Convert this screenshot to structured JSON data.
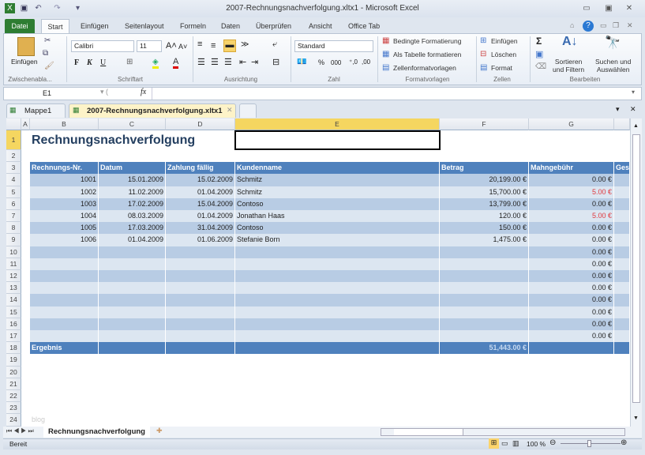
{
  "window": {
    "title": "2007-Rechnungsnachverfolgung.xltx1 - Microsoft Excel"
  },
  "ribbon_tabs": [
    "Datei",
    "Start",
    "Einfügen",
    "Seitenlayout",
    "Formeln",
    "Daten",
    "Überprüfen",
    "Ansicht",
    "Office Tab"
  ],
  "ribbon": {
    "clipboard": {
      "paste": "Einfügen",
      "label": "Zwischenabla..."
    },
    "font": {
      "name": "Calibri",
      "size": "11",
      "bold": "F",
      "italic": "K",
      "underline": "U",
      "label": "Schriftart"
    },
    "alignment": {
      "label": "Ausrichtung"
    },
    "number": {
      "format": "Standard",
      "percent": "%",
      "thousands": "000",
      "label": "Zahl"
    },
    "styles": {
      "conditional": "Bedingte Formatierung",
      "as_table": "Als Tabelle formatieren",
      "cell_styles": "Zellenformatvorlagen",
      "label": "Formatvorlagen"
    },
    "cells": {
      "insert": "Einfügen",
      "delete": "Löschen",
      "format": "Format",
      "label": "Zellen"
    },
    "editing": {
      "sort": "Sortieren\nund Filtern",
      "find": "Suchen und\nAuswählen",
      "label": "Bearbeiten",
      "sigma": "Σ"
    }
  },
  "formula_bar": {
    "name_box": "E1",
    "fx": "fx",
    "value": ""
  },
  "doc_tabs": [
    {
      "label": "Mappe1",
      "active": false
    },
    {
      "label": "2007-Rechnungsnachverfolgung.xltx1",
      "active": true
    }
  ],
  "columns": [
    "A",
    "B",
    "C",
    "D",
    "E",
    "F",
    "G"
  ],
  "sheet": {
    "title": "Rechnungsnachverfolgung",
    "headers": [
      "Rechnungs-Nr.",
      "Datum",
      "Zahlung fällig",
      "Kundenname",
      "Betrag",
      "Mahngebühr",
      "Ges"
    ],
    "rows": [
      [
        "1001",
        "15.01.2009",
        "15.02.2009",
        "Schmitz",
        "20,199.00 €",
        "0.00 €"
      ],
      [
        "1002",
        "11.02.2009",
        "01.04.2009",
        "Schmitz",
        "15,700.00 €",
        "5.00 €"
      ],
      [
        "1003",
        "17.02.2009",
        "15.04.2009",
        "Contoso",
        "13,799.00 €",
        "0.00 €"
      ],
      [
        "1004",
        "08.03.2009",
        "01.04.2009",
        "Jonathan Haas",
        "120.00 €",
        "5.00 €"
      ],
      [
        "1005",
        "17.03.2009",
        "31.04.2009",
        "Contoso",
        "150.00 €",
        "0.00 €"
      ],
      [
        "1006",
        "01.04.2009",
        "01.06.2009",
        "Stefanie Born",
        "1,475.00 €",
        "0.00 €"
      ],
      [
        "",
        "",
        "",
        "",
        "",
        "0.00 €"
      ],
      [
        "",
        "",
        "",
        "",
        "",
        "0.00 €"
      ],
      [
        "",
        "",
        "",
        "",
        "",
        "0.00 €"
      ],
      [
        "",
        "",
        "",
        "",
        "",
        "0.00 €"
      ],
      [
        "",
        "",
        "",
        "",
        "",
        "0.00 €"
      ],
      [
        "",
        "",
        "",
        "",
        "",
        "0.00 €"
      ],
      [
        "",
        "",
        "",
        "",
        "",
        "0.00 €"
      ],
      [
        "",
        "",
        "",
        "",
        "",
        "0.00 €"
      ]
    ],
    "late_fee_color": "#e0393e",
    "total_label": "Ergebnis",
    "total_value": "51,443.00 €",
    "watermark": "blog"
  },
  "sheet_tabs": [
    "Rechnungsnachverfolgung"
  ],
  "status": {
    "ready": "Bereit",
    "zoom": "100 %"
  }
}
